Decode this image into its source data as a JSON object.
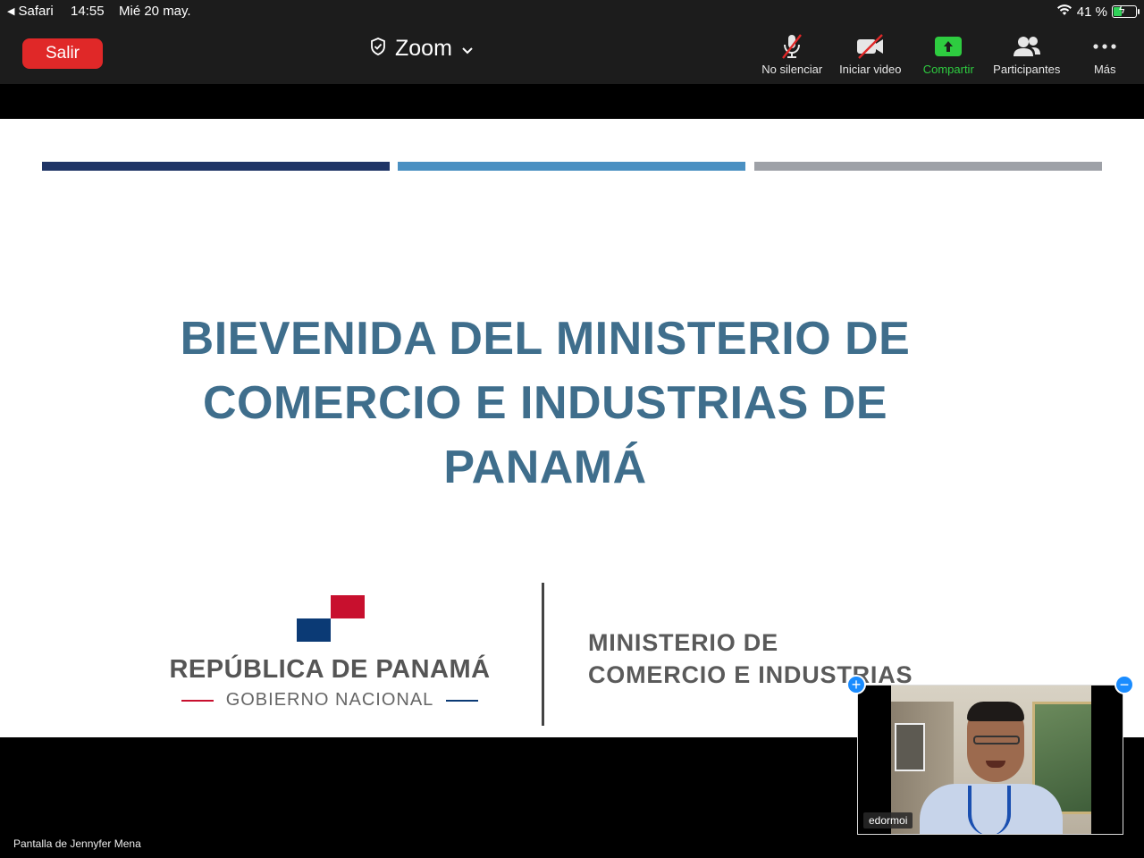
{
  "status_bar": {
    "back_label": "Safari",
    "time": "14:55",
    "date": "Mié 20 may.",
    "battery": "41 %",
    "battery_level": 0.41,
    "icons": [
      "wifi-icon",
      "battery-icon"
    ]
  },
  "toolbar": {
    "leave_label": "Salir",
    "meeting_title": "Zoom",
    "items": [
      {
        "label": "No silenciar",
        "icon": "mic-muted-icon"
      },
      {
        "label": "Iniciar video",
        "icon": "video-off-icon"
      },
      {
        "label": "Compartir",
        "icon": "share-screen-icon"
      },
      {
        "label": "Participantes",
        "icon": "participants-icon"
      },
      {
        "label": "Más",
        "icon": "more-icon"
      }
    ],
    "colors": {
      "leave": "#e02828",
      "share": "#2ecc40"
    }
  },
  "slide": {
    "title": "BIEVENIDA DEL MINISTERIO DE COMERCIO E INDUSTRIAS DE PANAMÁ",
    "bars": [
      "#1f3566",
      "#4a90c2",
      "#9ea1a7"
    ],
    "title_color": "#3f6e8c",
    "logo_left": {
      "name": "REPÚBLICA DE PANAMÁ",
      "subtitle": "GOBIERNO NACIONAL"
    },
    "logo_right": {
      "line1": "MINISTERIO DE",
      "line2": "COMERCIO E INDUSTRIAS"
    }
  },
  "caption": "Pantalla de Jennyfer Mena",
  "video_tile": {
    "participant_name": "edormoi"
  }
}
